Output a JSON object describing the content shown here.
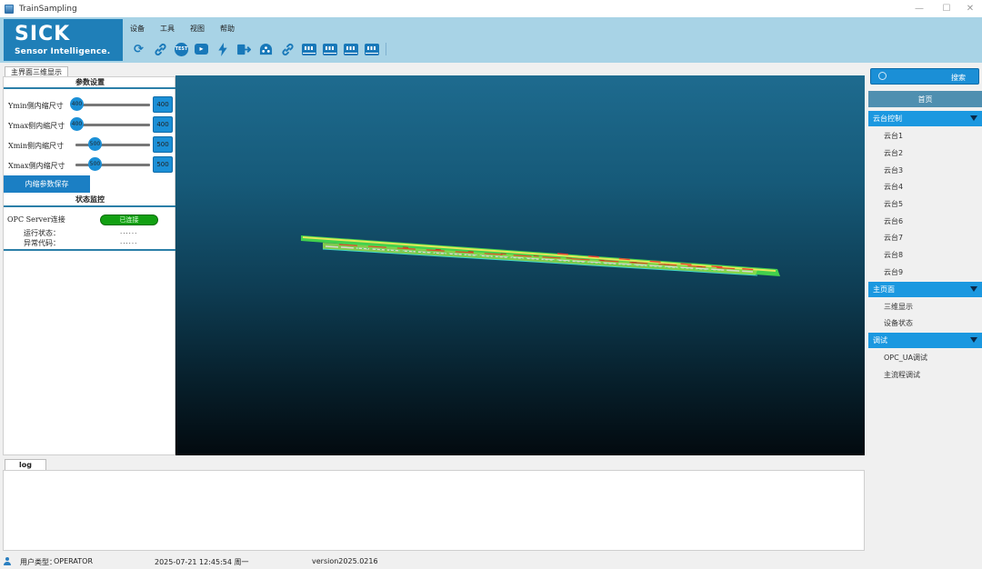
{
  "window": {
    "title": "TrainSampling",
    "controls": [
      "—",
      "☐",
      "✕"
    ]
  },
  "header": {
    "logo_main": "SICK",
    "logo_sub": "Sensor Intelligence.",
    "menu": [
      "设备",
      "工具",
      "视图",
      "帮助"
    ],
    "toolbar_icons": [
      "refresh-icon",
      "link-icon",
      "test-icon",
      "play-icon",
      "lightning-icon",
      "export-icon",
      "network-icon",
      "link-icon",
      "train-car-icon",
      "train-car-icon",
      "train-car-icon",
      "train-car-icon"
    ],
    "toolbar_test_label": "TEST",
    "accent": "#1878b9",
    "band_color": "#a8d3e6"
  },
  "left": {
    "tab_label": "主界面三维显示",
    "param_title": "参数设置",
    "params": [
      {
        "label": "Ymin侧内缩尺寸",
        "value": "400",
        "spin": "400",
        "level": 0.0
      },
      {
        "label": "Ymax侧内缩尺寸",
        "value": "400",
        "spin": "400",
        "level": 0.0
      },
      {
        "label": "Xmin侧内缩尺寸",
        "value": "500",
        "spin": "500",
        "level": 0.25
      },
      {
        "label": "Xmax侧内缩尺寸",
        "value": "500",
        "spin": "500",
        "level": 0.25
      }
    ],
    "save_label": "内缩参数保存",
    "status_title": "状态监控",
    "opc_label": "OPC Server连接",
    "opc_status": "已连接",
    "run_label": "运行状态：",
    "run_value": "......",
    "err_label": "异常代码：",
    "err_value": "......",
    "connected_color": "#12a012"
  },
  "log": {
    "tab_label": "log"
  },
  "right": {
    "search_label": "搜索",
    "home_label": "首页",
    "groups": [
      {
        "label": "云台控制",
        "items": [
          "云台1",
          "云台2",
          "云台3",
          "云台4",
          "云台5",
          "云台6",
          "云台7",
          "云台8",
          "云台9"
        ]
      },
      {
        "label": "主页面",
        "items": [
          "三维显示",
          "设备状态"
        ]
      },
      {
        "label": "调试",
        "items": [
          "OPC_UA调试",
          "主流程调试"
        ]
      }
    ],
    "group_color": "#1b98e0"
  },
  "status": {
    "user_type_label": "用户类型：",
    "user_type": "OPERATOR",
    "datetime": "2025-07-21 12:45:54 周一",
    "version": "version2025.0216"
  }
}
